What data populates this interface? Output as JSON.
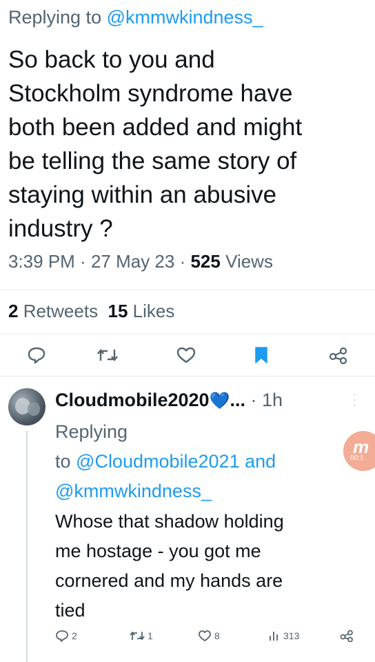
{
  "tweet": {
    "replying_prefix": "Replying to ",
    "replying_handle": "@kmmwkindness_",
    "text_lines": [
      "So back to you and",
      "Stockholm syndrome have",
      "both been added and might",
      "be telling the same story of",
      "staying within an abusive",
      "industry ?"
    ],
    "time": "3:39 PM",
    "sep1": " · ",
    "date": "27 May 23",
    "sep2": " · ",
    "views_count": "525",
    "views_label": " Views",
    "retweets_count": "2",
    "retweets_label": " Retweets",
    "likes_count": "15",
    "likes_label": " Likes"
  },
  "actions": {
    "icons": [
      "reply-icon",
      "retweet-icon",
      "like-icon",
      "bookmark-icon",
      "share-icon"
    ],
    "bookmark_color": "#1d9bf0"
  },
  "reply": {
    "name": "Cloudmobile2020",
    "verified_emoji": "💙",
    "ellipsis": "...",
    "time": " · 1h",
    "replying_line1": "Replying",
    "replying_to_word": "to ",
    "replying_handle1": "@Cloudmobile2021",
    "replying_and": " and",
    "replying_handle2": "@kmmwkindness_",
    "text_lines": [
      "Whose that shadow holding",
      "me hostage - you got me",
      "cornered and my hands are",
      "tied"
    ],
    "reply_count": "2",
    "retweet_count": "1",
    "like_count": "8",
    "views_count": "313"
  },
  "overlay": {
    "mark": "m",
    "time": "00:1"
  },
  "colors": {
    "accent": "#1d9bf0",
    "text": "#0f1419",
    "muted": "#536471"
  }
}
